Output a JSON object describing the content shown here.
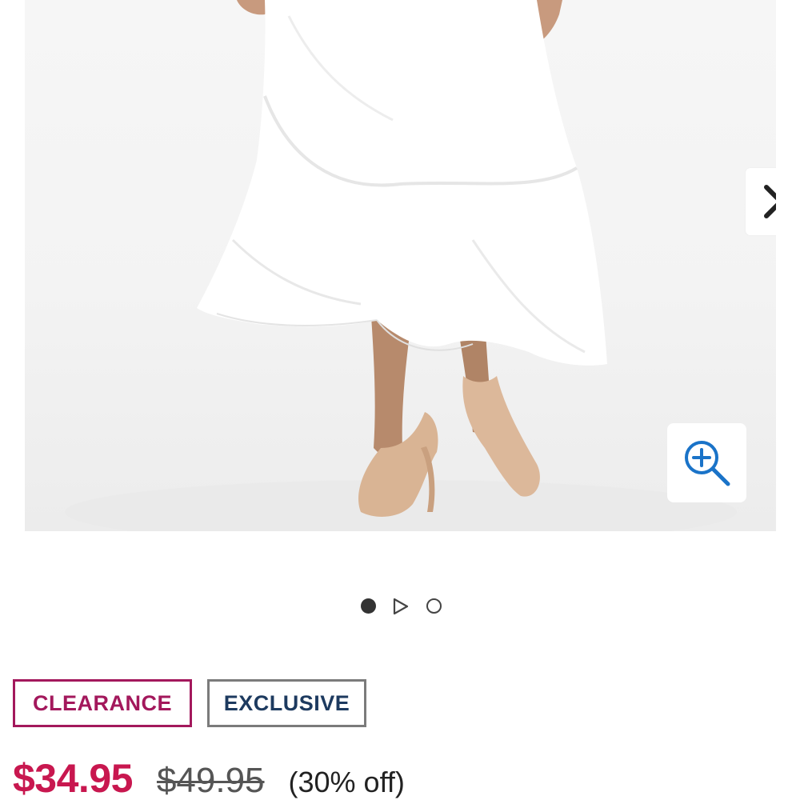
{
  "gallery": {
    "image_alt": "Model wearing white ruffle wrap maxi skirt with nude slingback heels",
    "next_icon": "chevron-right-icon",
    "zoom_icon": "zoom-in-icon",
    "accent_color": "#1a73c8",
    "dots": [
      {
        "type": "image",
        "active": true
      },
      {
        "type": "video",
        "active": false
      },
      {
        "type": "image",
        "active": false
      }
    ]
  },
  "badges": {
    "clearance": "CLEARANCE",
    "exclusive": "EXCLUSIVE",
    "clearance_color": "#a3185c",
    "exclusive_color": "#1d3a5f"
  },
  "price": {
    "current": "$34.95",
    "original": "$49.95",
    "discount": "(30% off)",
    "current_color": "#c8174f"
  }
}
